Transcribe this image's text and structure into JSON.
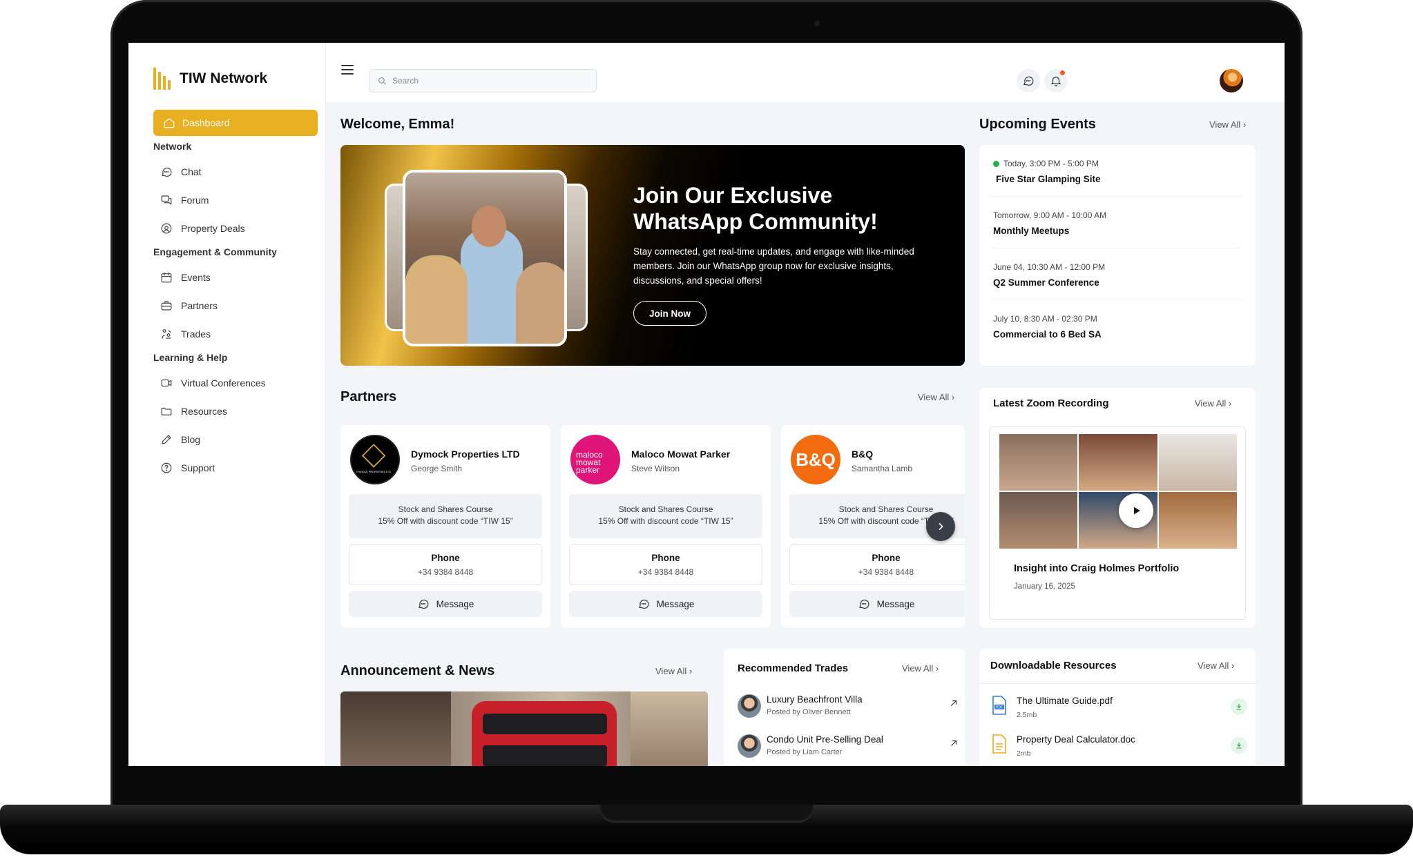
{
  "app": {
    "name": "TIW Network"
  },
  "sidebar": {
    "active": {
      "label": "Dashboard"
    },
    "sections": [
      {
        "title": "Network",
        "items": [
          {
            "label": "Chat",
            "icon": "chat-icon"
          },
          {
            "label": "Forum",
            "icon": "forum-icon"
          },
          {
            "label": "Property Deals",
            "icon": "property-deals-icon"
          }
        ]
      },
      {
        "title": "Engagement & Community",
        "items": [
          {
            "label": "Events",
            "icon": "calendar-icon"
          },
          {
            "label": "Partners",
            "icon": "briefcase-icon"
          },
          {
            "label": "Trades",
            "icon": "trades-icon"
          }
        ]
      },
      {
        "title": "Learning & Help",
        "items": [
          {
            "label": "Virtual Conferences",
            "icon": "video-icon"
          },
          {
            "label": "Resources",
            "icon": "folder-icon"
          },
          {
            "label": "Blog",
            "icon": "pencil-icon"
          },
          {
            "label": "Support",
            "icon": "help-icon"
          }
        ]
      }
    ]
  },
  "topbar": {
    "search_placeholder": "Search",
    "has_notification": true
  },
  "welcome": "Welcome, Emma!",
  "banner": {
    "title": "Join Our Exclusive WhatsApp Community!",
    "text": "Stay connected, get real-time updates, and engage with like-minded members. Join our WhatsApp group now for exclusive insights, discussions, and special offers!",
    "button": "Join Now"
  },
  "partners": {
    "title": "Partners",
    "view_all": "View All",
    "items": [
      {
        "name": "Dymock Properties LTD",
        "person": "George Smith",
        "offer_line1": "Stock and Shares Course",
        "offer_line2": "15% Off with discount code “TIW 15”",
        "phone_label": "Phone",
        "phone": "+34 9384 8448",
        "message": "Message",
        "logo_text": "DYMOCK PROPERTIES LTD",
        "logo_bg": "#000000"
      },
      {
        "name": "Maloco Mowat Parker",
        "person": "Steve Wilson",
        "offer_line1": "Stock and Shares Course",
        "offer_line2": "15% Off with discount code “TIW 15”",
        "phone_label": "Phone",
        "phone": "+34 9384 8448",
        "message": "Message",
        "logo_text": "maloco mowat parker",
        "logo_bg": "#e0157a"
      },
      {
        "name": "B&Q",
        "person": "Samantha Lamb",
        "offer_line1": "Stock and Shares Course",
        "offer_line2": "15% Off with discount code “TIW 15”",
        "phone_label": "Phone",
        "phone": "+34 9384 8448",
        "message": "Message",
        "logo_text": "B&Q",
        "logo_bg": "#f26b0f"
      }
    ]
  },
  "events": {
    "title": "Upcoming Events",
    "view_all": "View All",
    "items": [
      {
        "time": "Today, 3:00 PM - 5:00 PM",
        "name": "Five Star Glamping Site",
        "live": true
      },
      {
        "time": "Tomorrow, 9:00 AM - 10:00 AM",
        "name": "Monthly Meetups",
        "live": false
      },
      {
        "time": "June 04, 10:30 AM - 12:00 PM",
        "name": "Q2 Summer Conference",
        "live": false
      },
      {
        "time": "July 10, 8:30 AM - 02:30 PM",
        "name": "Commercial to 6 Bed SA",
        "live": false
      }
    ]
  },
  "zoom": {
    "title": "Latest Zoom Recording",
    "view_all": "View All",
    "video_title": "Insight into Craig Holmes Portfolio",
    "date": "January 16, 2025"
  },
  "news": {
    "title": "Announcement & News",
    "view_all": "View All"
  },
  "trades": {
    "title": "Recommended Trades",
    "view_all": "View All",
    "items": [
      {
        "name": "Luxury Beachfront Villa",
        "by": "Posted by Oliver Bennett"
      },
      {
        "name": "Condo Unit Pre-Selling Deal",
        "by": "Posted by Liam Carter"
      }
    ]
  },
  "resources": {
    "title": "Downloadable Resources",
    "view_all": "View All",
    "items": [
      {
        "name": "The Ultimate Guide.pdf",
        "size": "2.5mb",
        "icon": "pdf-file-icon"
      },
      {
        "name": "Property Deal Calculator.doc",
        "size": "2mb",
        "icon": "doc-file-icon"
      }
    ]
  },
  "colors": {
    "accent": "#e8b021",
    "live": "#22b14c",
    "notification": "#f05a28"
  }
}
